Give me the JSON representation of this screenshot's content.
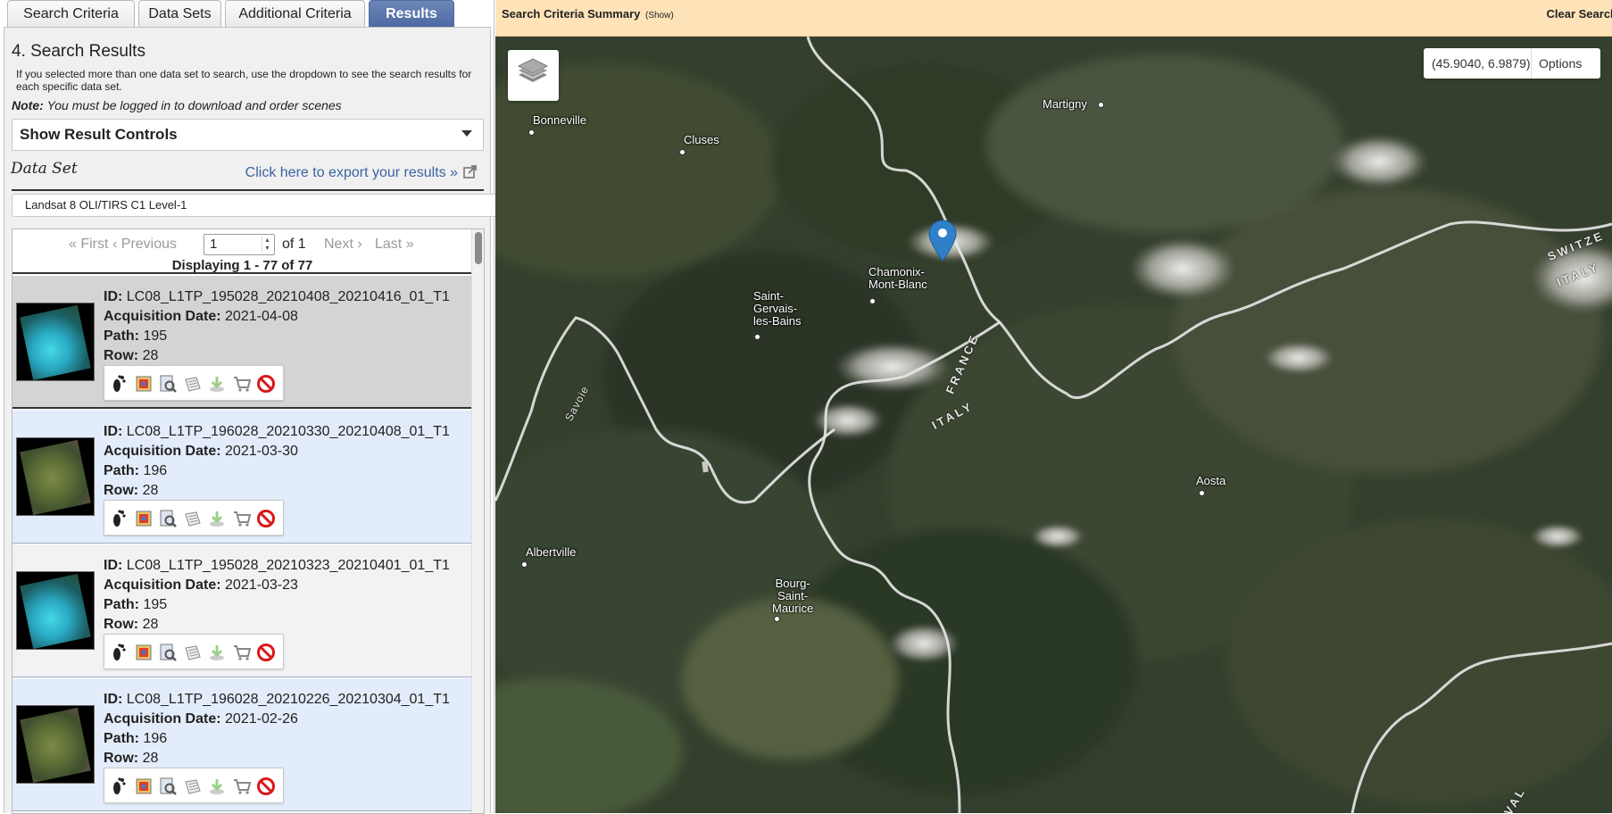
{
  "tabs": [
    "Search Criteria",
    "Data Sets",
    "Additional Criteria",
    "Results"
  ],
  "results": {
    "section_title": "4. Search Results",
    "instructions": "If you selected more than one data set to search, use the dropdown to see the search results for each specific data set.",
    "note_label": "Note:",
    "note_text": "You must be logged in to download and order scenes",
    "controls_label": "Show Result Controls",
    "dataset_label": "Data Set",
    "export_link": "Click here to export your results »",
    "dataset_selected": "Landsat 8 OLI/TIRS C1 Level-1",
    "pager": {
      "first": "« First",
      "previous": "‹ Previous",
      "page": "1",
      "of": "of 1",
      "next": "Next ›",
      "last": "Last »",
      "displaying": "Displaying 1 - 77 of 77"
    },
    "labels": {
      "id": "ID:",
      "date": "Acquisition Date:",
      "path": "Path:",
      "row": "Row:"
    },
    "items": [
      {
        "id": "LC08_L1TP_195028_20210408_20210416_01_T1",
        "date": "2021-04-08",
        "path": "195",
        "row": "28"
      },
      {
        "id": "LC08_L1TP_196028_20210330_20210408_01_T1",
        "date": "2021-03-30",
        "path": "196",
        "row": "28"
      },
      {
        "id": "LC08_L1TP_195028_20210323_20210401_01_T1",
        "date": "2021-03-23",
        "path": "195",
        "row": "28"
      },
      {
        "id": "LC08_L1TP_196028_20210226_20210304_01_T1",
        "date": "2021-02-26",
        "path": "196",
        "row": "28"
      }
    ],
    "tool_icons": [
      "footprint-icon",
      "browse-overlay-icon",
      "metadata-icon",
      "compare-icon",
      "download-icon",
      "cart-icon",
      "exclude-icon"
    ]
  },
  "map": {
    "summary_title": "Search Criteria Summary",
    "summary_show": "(Show)",
    "clear": "Clear Search",
    "coordinates": "(45.9040, 6.9879)",
    "options": "Options",
    "places": {
      "bonneville": "Bonneville",
      "cluses": "Cluses",
      "martigny": "Martigny",
      "chamonix": "Chamonix-\nMont-Blanc",
      "saint_gervais": "Saint-\nGervais-\nles-Bains",
      "savoie": "Savoie",
      "albertville": "Albertville",
      "aosta": "Aosta",
      "bourg": "Bourg-\nSaint-\nMaurice",
      "france": "FRANCE",
      "italy": "ITALY",
      "switzerland": "SWITZE",
      "italy2": "ITALY",
      "val": "VAL"
    }
  },
  "colors": {
    "tab_active": "#4d6aa3",
    "link": "#3b63a3",
    "summary_bg": "#ffe3b8",
    "row_odd": "#e3ecfa",
    "row_selected": "#d4d4d4"
  }
}
